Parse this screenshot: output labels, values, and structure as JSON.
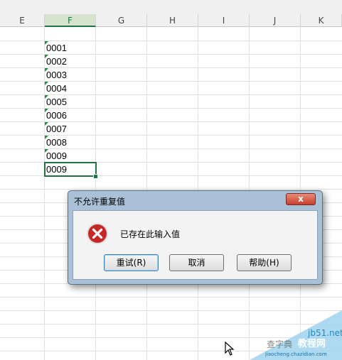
{
  "columns": [
    "E",
    "F",
    "G",
    "H",
    "I",
    "J",
    "K"
  ],
  "selected_column": "F",
  "cells": [
    "0001",
    "0002",
    "0003",
    "0004",
    "0005",
    "0006",
    "0007",
    "0008",
    "0009",
    "0009"
  ],
  "dialog": {
    "title": "不允许重复值",
    "close_label": "x",
    "message": "已存在此输入值",
    "buttons": {
      "retry": "重试(R)",
      "cancel": "取消",
      "help": "帮助(H)"
    }
  },
  "watermark": {
    "line1": "jb51.net",
    "line2": "教程网",
    "line3": "jiaocheng.chazidian.com",
    "line4": "查字典"
  },
  "colors": {
    "accent": "#217346",
    "error": "#c62828"
  }
}
